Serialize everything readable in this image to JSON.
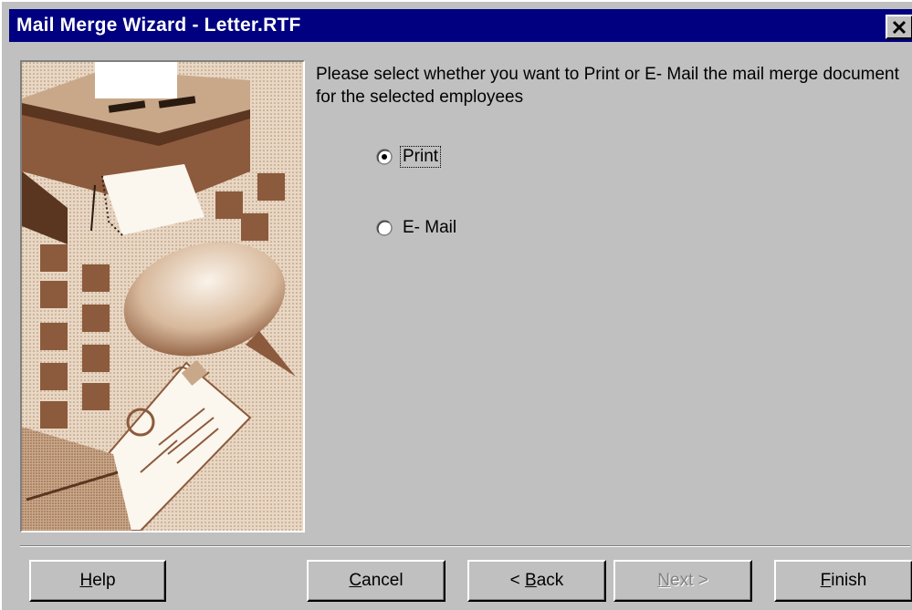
{
  "window": {
    "title": "Mail Merge Wizard - Letter.RTF",
    "close_glyph": "✕"
  },
  "instructions": "Please select whether you want to Print or E- Mail the mail merge document for the selected employees",
  "options": {
    "print": {
      "label": "Print",
      "selected": true
    },
    "email": {
      "label": "E- Mail",
      "selected": false
    }
  },
  "buttons": {
    "help": {
      "accel": "H",
      "rest": "elp"
    },
    "cancel": {
      "accel": "C",
      "rest": "ancel"
    },
    "back": {
      "pre": "< ",
      "accel": "B",
      "rest": "ack"
    },
    "next": {
      "accel": "N",
      "rest": "ext >",
      "enabled": false
    },
    "finish": {
      "accel": "F",
      "rest": "inish"
    }
  },
  "colors": {
    "titlebar": "#000080",
    "face": "#c0c0c0",
    "art_dark": "#8c5a3c",
    "art_light": "#e8d7c4"
  }
}
